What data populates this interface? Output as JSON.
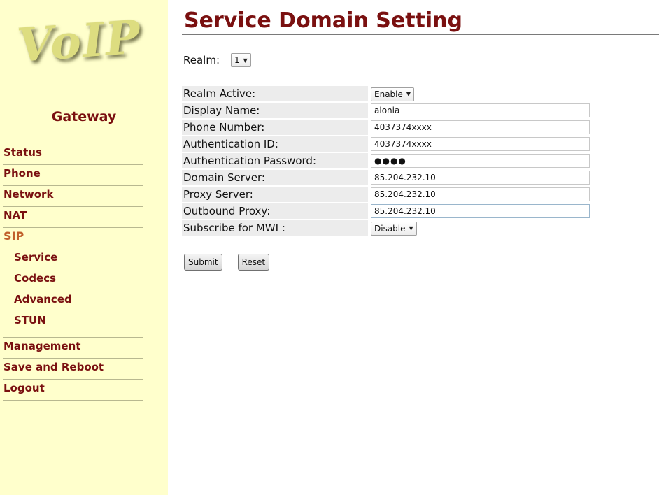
{
  "logo": {
    "text": "VoIP"
  },
  "sidebar": {
    "subtitle": "Gateway",
    "items": [
      {
        "label": "Status"
      },
      {
        "label": "Phone"
      },
      {
        "label": "Network"
      },
      {
        "label": "NAT"
      },
      {
        "label": "SIP",
        "active": true
      }
    ],
    "sip_subitems": [
      {
        "label": "Service"
      },
      {
        "label": "Codecs"
      },
      {
        "label": "Advanced"
      },
      {
        "label": "STUN"
      }
    ],
    "bottom_items": [
      {
        "label": "Management"
      },
      {
        "label": "Save and Reboot"
      },
      {
        "label": "Logout"
      }
    ]
  },
  "page": {
    "title": "Service Domain Setting",
    "realm_label": "Realm:",
    "realm_value": "1"
  },
  "form": {
    "realm_active": {
      "label": "Realm Active:",
      "value": "Enable"
    },
    "display_name": {
      "label": "Display Name:",
      "value": "alonia"
    },
    "phone_number": {
      "label": "Phone Number:",
      "value": "4037374xxxx"
    },
    "auth_id": {
      "label": "Authentication ID:",
      "value": "4037374xxxx"
    },
    "auth_password": {
      "label": "Authentication Password:",
      "value": "●●●●"
    },
    "domain_server": {
      "label": "Domain Server:",
      "value": "85.204.232.10"
    },
    "proxy_server": {
      "label": "Proxy Server:",
      "value": "85.204.232.10"
    },
    "outbound_proxy": {
      "label": "Outbound Proxy:",
      "value": "85.204.232.10"
    },
    "subscribe_mwi": {
      "label": "Subscribe for MWI :",
      "value": "Disable"
    }
  },
  "buttons": {
    "submit": "Submit",
    "reset": "Reset"
  },
  "colors": {
    "sidebar_bg": "#ffffcc",
    "brand_maroon": "#7a1010",
    "active_orange": "#c0602a",
    "label_bg": "#ececec"
  }
}
